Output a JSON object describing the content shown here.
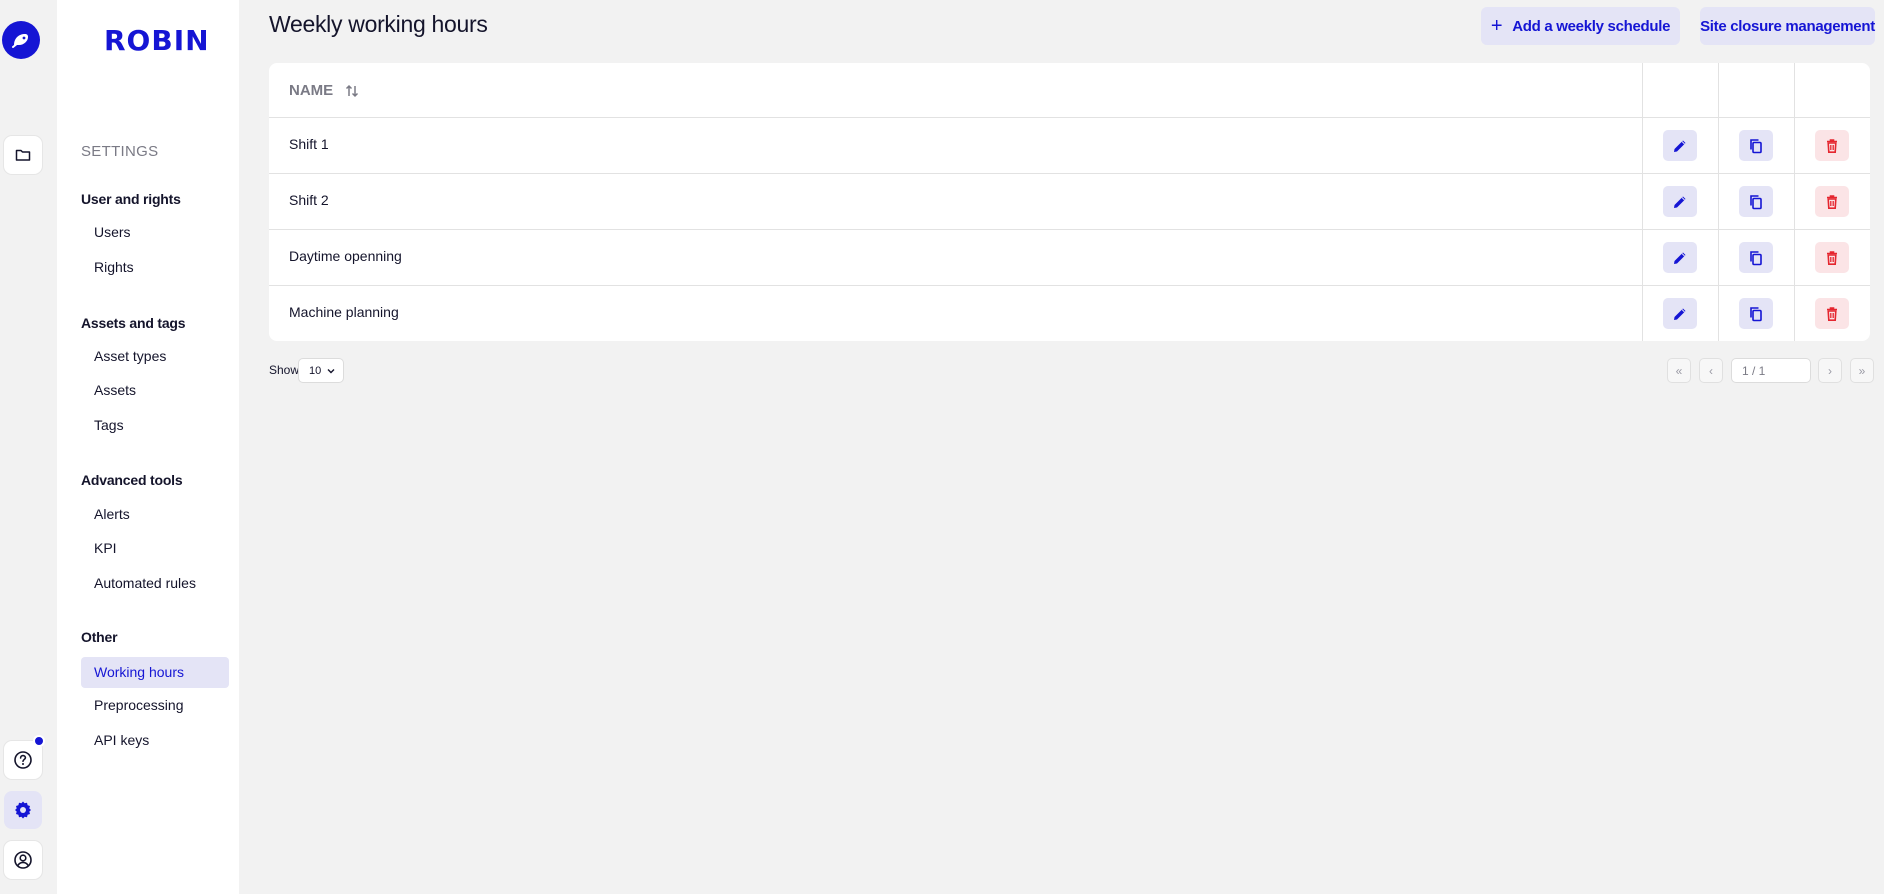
{
  "app": {
    "brand": "ROBIN"
  },
  "rail": {
    "items": [
      {
        "icon": "robin-logo-icon"
      },
      {
        "icon": "folder-icon"
      },
      {
        "icon": "help-icon",
        "notification": true
      },
      {
        "icon": "gear-icon",
        "active": true
      },
      {
        "icon": "user-circle-icon"
      }
    ]
  },
  "sidebar": {
    "section_label": "SETTINGS",
    "groups": [
      {
        "title": "User and rights",
        "items": [
          "Users",
          "Rights"
        ]
      },
      {
        "title": "Assets and tags",
        "items": [
          "Asset types",
          "Assets",
          "Tags"
        ]
      },
      {
        "title": "Advanced tools",
        "items": [
          "Alerts",
          "KPI",
          "Automated rules"
        ]
      },
      {
        "title": "Other",
        "items": [
          "Working hours",
          "Preprocessing",
          "API keys"
        ]
      }
    ],
    "active_item": "Working hours"
  },
  "header": {
    "title": "Weekly working hours",
    "add_button": "Add a weekly schedule",
    "site_closure_button": "Site closure management"
  },
  "table": {
    "columns": [
      "NAME"
    ],
    "rows": [
      {
        "name": "Shift 1"
      },
      {
        "name": "Shift 2"
      },
      {
        "name": "Daytime openning"
      },
      {
        "name": "Machine planning"
      }
    ],
    "row_actions": [
      "edit-icon",
      "copy-icon",
      "delete-icon"
    ]
  },
  "pagination": {
    "show_label": "Show",
    "page_size": "10",
    "page_indicator": "1 / 1",
    "first": "«",
    "prev": "‹",
    "next": "›",
    "last": "»"
  },
  "colors": {
    "accent": "#1515d4",
    "accent_light": "#e4e4f6",
    "danger": "#e5262f",
    "danger_light": "#fbe4e6",
    "background": "#f2f2f2"
  }
}
